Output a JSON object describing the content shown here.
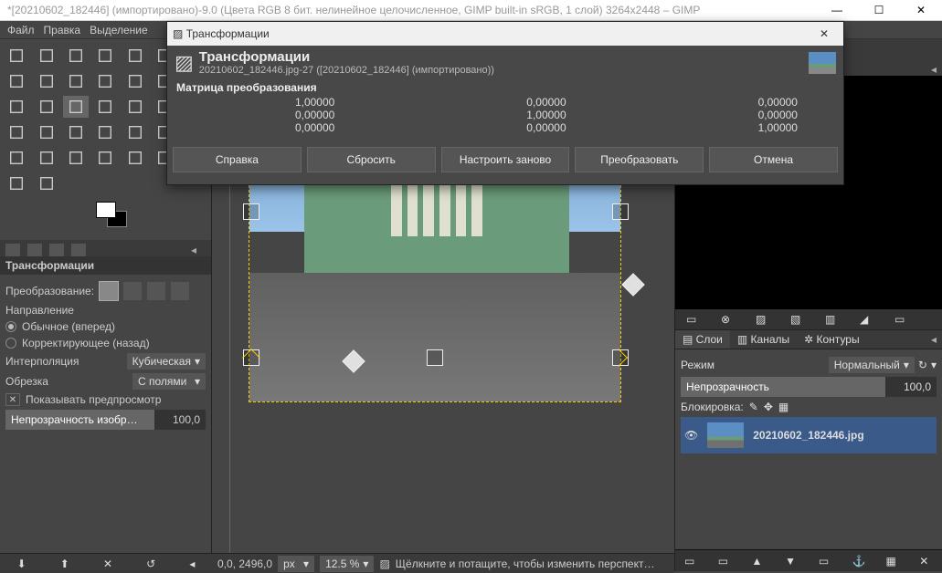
{
  "window": {
    "title": "*[20210602_182446] (импортировано)-9.0 (Цвета RGB 8 бит. нелинейное целочисленное, GIMP built-in sRGB, 1 слой) 3264x2448 – GIMP"
  },
  "menu": [
    "Файл",
    "Правка",
    "Выделение"
  ],
  "toolbox_icons": [
    [
      "rect-select-icon",
      "ellipse-select-icon",
      "free-select-icon",
      "fuzzy-select-icon",
      "paths-icon",
      "color-picker-icon",
      "bucket-icon"
    ],
    [
      "scissors-icon",
      "foreground-select-icon",
      "crop-icon",
      "move-icon",
      "zoom-icon",
      "measure-icon",
      "align-icon"
    ],
    [
      "rotate-icon",
      "scale-icon",
      "shear-icon",
      "perspective-icon",
      "flip-icon",
      "cage-icon",
      "warp-icon"
    ],
    [
      "text-icon",
      "gradient-icon",
      "pencil-icon",
      "paintbrush-icon",
      "eraser-icon",
      "airbrush-icon",
      "ink-icon"
    ],
    [
      "clone-icon",
      "heal-icon",
      "blur-icon",
      "smudge-icon",
      "dodge-icon",
      "mypaint-icon",
      "colorize-icon"
    ],
    [
      "unified-transform-icon",
      "handle-transform-icon",
      "",
      "",
      "",
      "",
      ""
    ]
  ],
  "tool_options": {
    "title": "Трансформации",
    "transform_label": "Преобразование:",
    "direction_label": "Направление",
    "direction_forward": "Обычное (вперед)",
    "direction_backward": "Корректирующее (назад)",
    "interpolation_label": "Интерполяция",
    "interpolation_value": "Кубическая",
    "clip_label": "Обрезка",
    "clip_value": "С полями",
    "preview_label": "Показывать предпросмотр",
    "opacity_label": "Непрозрачность изобр…",
    "opacity_value": "100,0"
  },
  "statusbar": {
    "coords": "0,0, 2496,0",
    "unit": "px",
    "zoom": "12.5 %",
    "hint": "Щёлкните и потащите, чтобы изменить перспект…"
  },
  "right": {
    "tabs": [
      "Слои",
      "Каналы",
      "Контуры"
    ],
    "mode_label": "Режим",
    "mode_value": "Нормальный",
    "opacity_label": "Непрозрачность",
    "opacity_value": "100,0",
    "lock_label": "Блокировка:",
    "layer_name": "20210602_182446.jpg"
  },
  "dialog": {
    "win_title": "Трансформации",
    "title": "Трансформации",
    "subtitle": "20210602_182446.jpg-27 ([20210602_182446] (импортировано))",
    "matrix_label": "Матрица преобразования",
    "matrix": [
      [
        "1,00000",
        "0,00000",
        "0,00000"
      ],
      [
        "0,00000",
        "1,00000",
        "0,00000"
      ],
      [
        "0,00000",
        "0,00000",
        "1,00000"
      ]
    ],
    "buttons": [
      "Справка",
      "Сбросить",
      "Настроить заново",
      "Преобразовать",
      "Отмена"
    ]
  }
}
